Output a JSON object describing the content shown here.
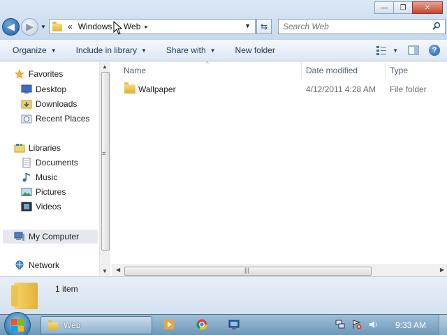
{
  "window": {
    "controls": {
      "minimize": "—",
      "maximize": "❐",
      "close": "✕"
    }
  },
  "navigation": {
    "back_glyph": "◀",
    "forward_glyph": "▶",
    "address": {
      "overflow": "«",
      "crumbs": [
        "Windows",
        "Web"
      ],
      "separator": "▸"
    },
    "refresh_glyph": "⇆",
    "search": {
      "placeholder": "Search Web"
    }
  },
  "toolbar": {
    "organize": "Organize",
    "include_in_library": "Include in library",
    "share_with": "Share with",
    "new_folder": "New folder",
    "help": "?"
  },
  "sidebar": {
    "favorites": {
      "label": "Favorites",
      "items": [
        {
          "label": "Desktop",
          "icon": "desktop-icon"
        },
        {
          "label": "Downloads",
          "icon": "downloads-icon"
        },
        {
          "label": "Recent Places",
          "icon": "recent-places-icon"
        }
      ]
    },
    "libraries": {
      "label": "Libraries",
      "items": [
        {
          "label": "Documents",
          "icon": "documents-icon"
        },
        {
          "label": "Music",
          "icon": "music-icon"
        },
        {
          "label": "Pictures",
          "icon": "pictures-icon"
        },
        {
          "label": "Videos",
          "icon": "videos-icon"
        }
      ]
    },
    "computer": {
      "label": "My Computer",
      "selected": true
    },
    "network": {
      "label": "Network"
    }
  },
  "filelist": {
    "columns": [
      "Name",
      "Date modified",
      "Type"
    ],
    "rows": [
      {
        "name": "Wallpaper",
        "date_modified": "4/12/2011 4:28 AM",
        "type": "File folder"
      }
    ]
  },
  "details": {
    "item_count": "1 item"
  },
  "taskbar": {
    "active_window": "Web",
    "pinned": [
      "media-player-icon",
      "chrome-icon",
      "network-monitor-icon"
    ],
    "tray_icons": [
      "network-tray-icon",
      "action-center-icon",
      "volume-icon"
    ],
    "clock": "9:33 AM"
  },
  "colors": {
    "accent": "#1e395b",
    "title_bg": "#c6d9ef",
    "taskbar": "#6e97b7",
    "close_button": "#c6452c"
  }
}
